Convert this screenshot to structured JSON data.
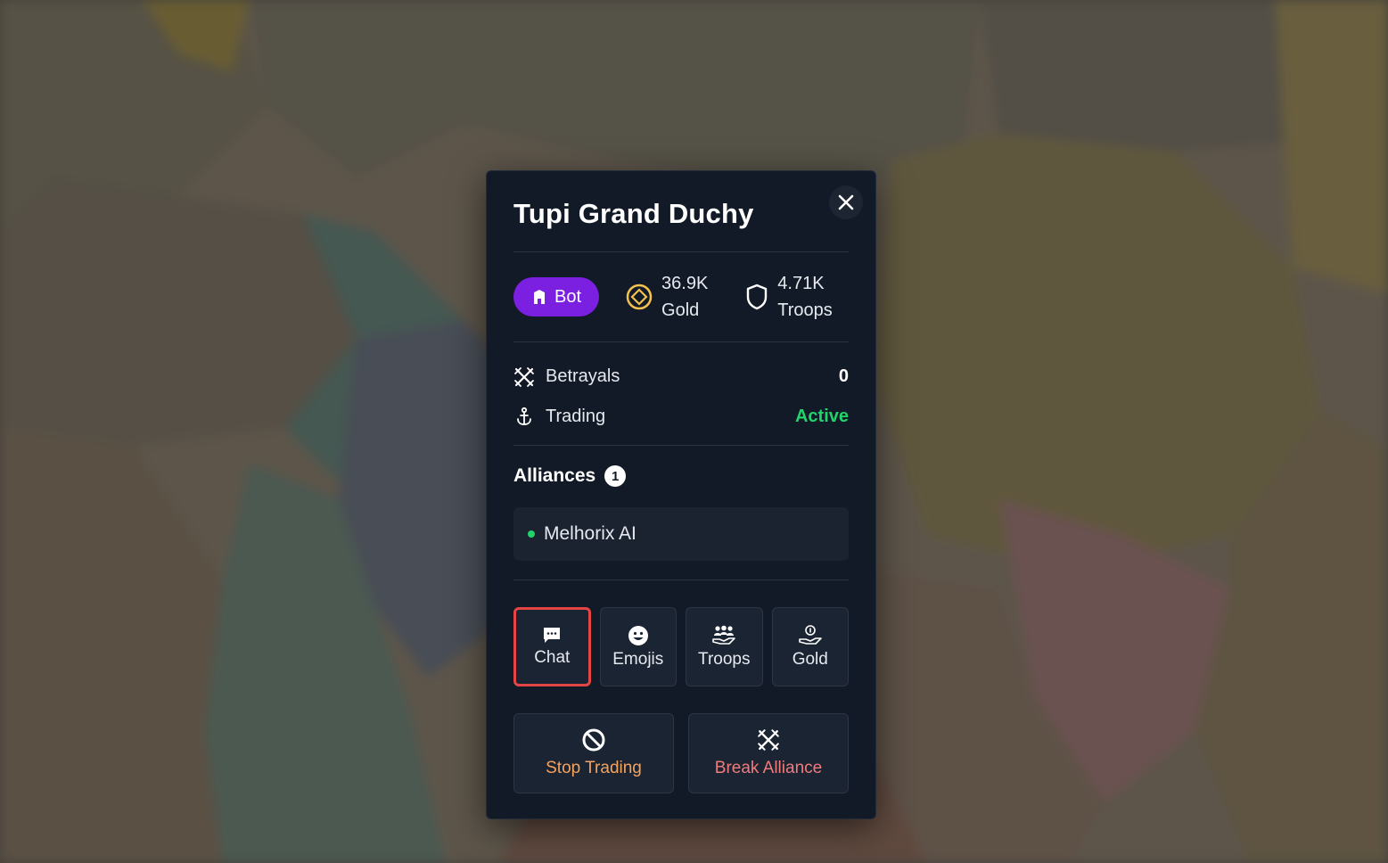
{
  "panel": {
    "title": "Tupi Grand Duchy",
    "badge": {
      "label": "Bot",
      "icon": "building-icon",
      "color": "#7b1fe0"
    },
    "stats": [
      {
        "value": "36.9K",
        "label": "Gold",
        "icon": "gold-coin-icon"
      },
      {
        "value": "4.71K",
        "label": "Troops",
        "icon": "shield-icon"
      }
    ],
    "rows": [
      {
        "label": "Betrayals",
        "value": "0",
        "icon": "crossed-swords-icon"
      },
      {
        "label": "Trading",
        "value": "Active",
        "icon": "anchor-icon",
        "value_color": "#22d36b"
      }
    ],
    "alliances": {
      "title": "Alliances",
      "count": "1",
      "items": [
        {
          "name": "Melhorix AI",
          "status_color": "#22d36b"
        }
      ]
    },
    "actions": [
      {
        "label": "Chat",
        "icon": "chat-bubble-icon"
      },
      {
        "label": "Emojis",
        "icon": "smiley-icon"
      },
      {
        "label": "Troops",
        "icon": "troops-icon"
      },
      {
        "label": "Gold",
        "icon": "gold-give-icon"
      }
    ],
    "big_actions": [
      {
        "label": "Stop Trading",
        "icon": "ban-icon",
        "color": "#f5a25d"
      },
      {
        "label": "Break Alliance",
        "icon": "crossed-swords-icon",
        "color": "#f07b7b"
      }
    ]
  }
}
